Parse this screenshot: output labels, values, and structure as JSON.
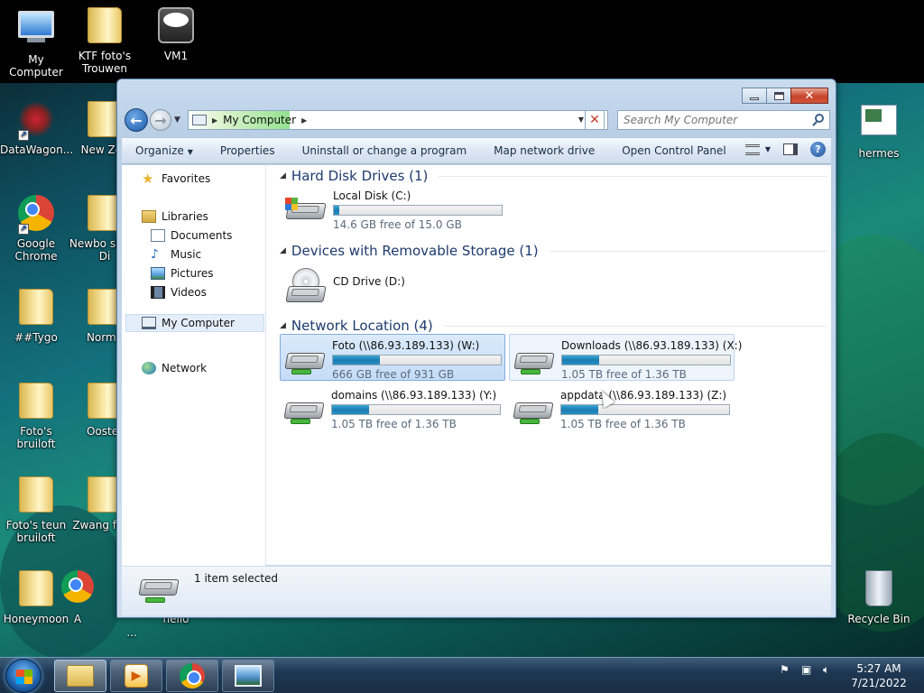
{
  "desktop": {
    "icons_left": [
      {
        "label": "My Computer"
      },
      {
        "label": "KTF foto's Trouwen"
      },
      {
        "label": "VM1"
      },
      {
        "label": "DataWagon..."
      },
      {
        "label": "New Zea"
      },
      {
        "label": "Google Chrome"
      },
      {
        "label": "Newbo shoot Di"
      },
      {
        "label": "##Tygo"
      },
      {
        "label": "Norma"
      },
      {
        "label": "Foto's bruiloft"
      },
      {
        "label": "Ooster"
      },
      {
        "label": "Foto's teun bruiloft"
      },
      {
        "label": "Zwang foto'"
      },
      {
        "label": "Honeymoon"
      },
      {
        "label": "A"
      },
      {
        "label": "hello"
      },
      {
        "label": "..."
      }
    ],
    "icons_right": [
      {
        "label": "hermes"
      },
      {
        "label": "Recycle Bin"
      }
    ]
  },
  "window": {
    "address": {
      "location": "My Computer"
    },
    "search": {
      "placeholder": "Search My Computer"
    },
    "toolbar": {
      "organize": "Organize",
      "properties": "Properties",
      "uninstall": "Uninstall or change a program",
      "map_drive": "Map network drive",
      "control_panel": "Open Control Panel"
    },
    "nav": {
      "favorites": "Favorites",
      "libraries": "Libraries",
      "documents": "Documents",
      "music": "Music",
      "pictures": "Pictures",
      "videos": "Videos",
      "my_computer": "My Computer",
      "network": "Network"
    },
    "groups": {
      "hdd": "Hard Disk Drives (1)",
      "removable": "Devices with Removable Storage (1)",
      "network": "Network Location (4)"
    },
    "drives": {
      "local_c": {
        "name": "Local Disk (C:)",
        "free": "14.6 GB free of 15.0 GB",
        "used_fraction": 0.03
      },
      "cd_d": {
        "name": "CD Drive (D:)"
      },
      "foto_w": {
        "name": "Foto (\\\\86.93.189.133) (W:)",
        "free": "666 GB free of 931 GB",
        "used_fraction": 0.28
      },
      "downloads_x": {
        "name": "Downloads (\\\\86.93.189.133) (X:)",
        "free": "1.05 TB free of 1.36 TB",
        "used_fraction": 0.22
      },
      "domains_y": {
        "name": "domains (\\\\86.93.189.133) (Y:)",
        "free": "1.05 TB free of 1.36 TB",
        "used_fraction": 0.22
      },
      "appdata_z": {
        "name": "appdata (\\\\86.93.189.133) (Z:)",
        "free": "1.05 TB free of 1.36 TB",
        "used_fraction": 0.22
      }
    },
    "details": {
      "status": "1 item selected"
    }
  },
  "taskbar": {
    "clock_time": "5:27 AM",
    "clock_date": "7/21/2022"
  },
  "icons": [
    "back-arrow-icon",
    "forward-arrow-icon",
    "search-icon",
    "refresh-icon",
    "views-icon",
    "preview-pane-icon",
    "help-icon",
    "favorites-star-icon",
    "libraries-icon",
    "documents-icon",
    "music-icon",
    "pictures-icon",
    "videos-icon",
    "computer-icon",
    "network-icon",
    "hard-drive-icon",
    "cd-drive-icon",
    "network-drive-icon",
    "windows-start-icon",
    "explorer-icon",
    "media-player-icon",
    "chrome-icon",
    "photo-viewer-icon",
    "action-center-icon",
    "network-status-icon",
    "volume-icon"
  ]
}
